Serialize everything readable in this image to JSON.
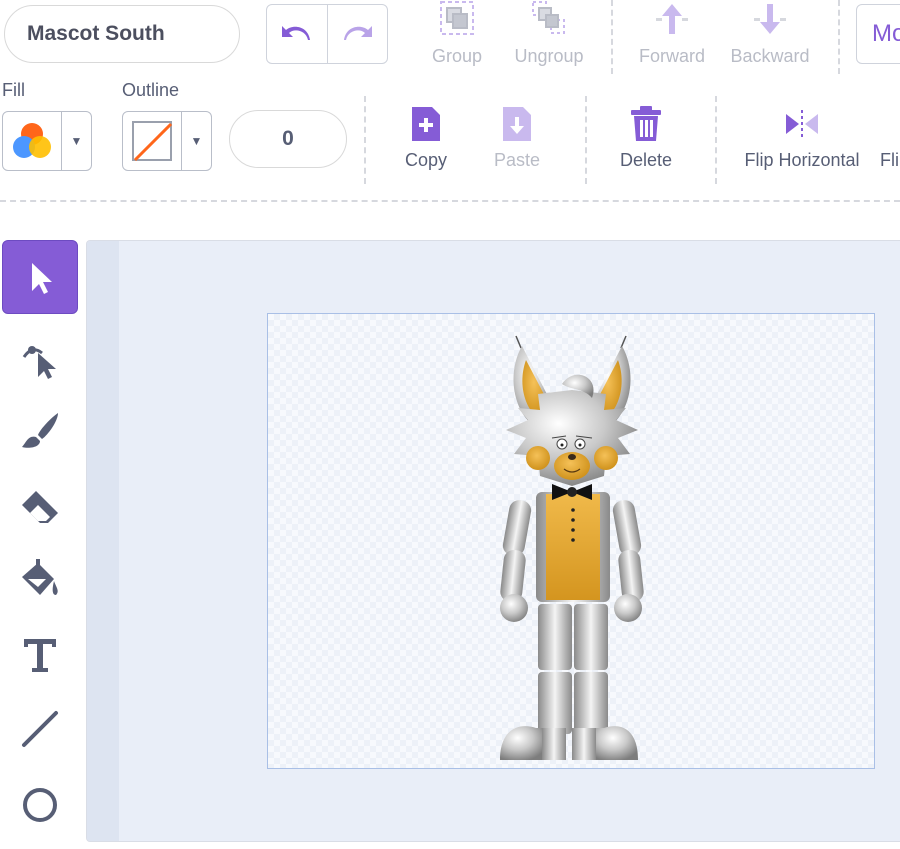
{
  "costume": {
    "name": "Mascot South"
  },
  "toolbar_top": {
    "group_label": "Group",
    "ungroup_label": "Ungroup",
    "forward_label": "Forward",
    "backward_label": "Backward",
    "more_label": "Mo"
  },
  "toolbar_bottom": {
    "fill_label": "Fill",
    "outline_label": "Outline",
    "outline_width": "0",
    "copy_label": "Copy",
    "paste_label": "Paste",
    "delete_label": "Delete",
    "flip_h_label": "Flip Horizontal",
    "flip_v_label": "Fli"
  },
  "colors": {
    "accent": "#855cd6",
    "disabled": "#b9bcc6",
    "text": "#575e75",
    "outline_none": "#ff661a"
  },
  "toolbox": [
    {
      "name": "select",
      "icon": "arrow-pointer-icon",
      "active": true
    },
    {
      "name": "reshape",
      "icon": "reshape-pointer-icon",
      "active": false
    },
    {
      "name": "brush",
      "icon": "brush-icon",
      "active": false
    },
    {
      "name": "eraser",
      "icon": "eraser-icon",
      "active": false
    },
    {
      "name": "fill",
      "icon": "paint-bucket-icon",
      "active": false
    },
    {
      "name": "text",
      "icon": "text-t-icon",
      "active": false
    },
    {
      "name": "line",
      "icon": "line-icon",
      "active": false
    },
    {
      "name": "circle",
      "icon": "circle-icon",
      "active": false
    }
  ]
}
